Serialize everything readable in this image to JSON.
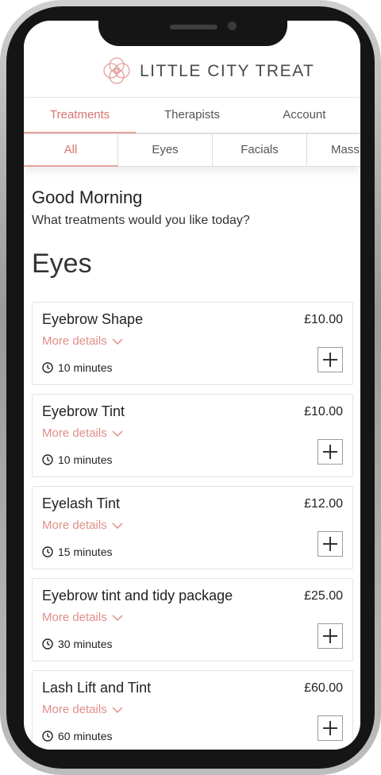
{
  "brand": {
    "name": "LITTLE CITY TREAT",
    "logo_icon": "lotus-logo-icon",
    "accent": "#d97570"
  },
  "main_tabs": [
    {
      "label": "Treatments",
      "active": true
    },
    {
      "label": "Therapists",
      "active": false
    },
    {
      "label": "Account",
      "active": false
    }
  ],
  "sub_tabs": [
    {
      "label": "All",
      "active": true
    },
    {
      "label": "Eyes",
      "active": false
    },
    {
      "label": "Facials",
      "active": false
    },
    {
      "label": "Mass",
      "active": false
    }
  ],
  "greeting": {
    "title": "Good Morning",
    "question": "What treatments would you like today?"
  },
  "section": {
    "title": "Eyes"
  },
  "treatments": [
    {
      "name": "Eyebrow Shape",
      "price": "£10.00",
      "more": "More details",
      "duration": "10 minutes"
    },
    {
      "name": "Eyebrow Tint",
      "price": "£10.00",
      "more": "More details",
      "duration": "10 minutes"
    },
    {
      "name": "Eyelash Tint",
      "price": "£12.00",
      "more": "More details",
      "duration": "15 minutes"
    },
    {
      "name": "Eyebrow tint and tidy package",
      "price": "£25.00",
      "more": "More details",
      "duration": "30 minutes"
    },
    {
      "name": "Lash Lift and Tint",
      "price": "£60.00",
      "more": "More details",
      "duration": "60 minutes"
    }
  ]
}
